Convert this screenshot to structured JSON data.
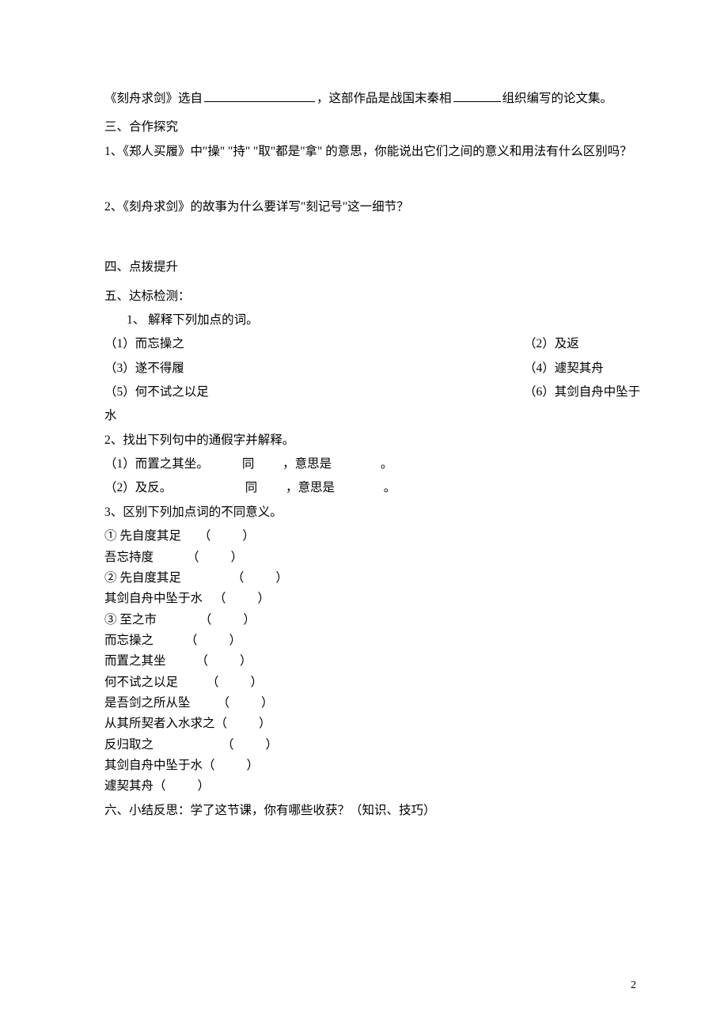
{
  "intro": {
    "text_a": "《刻舟求剑》选自",
    "text_b": "，这部作品是战国末秦相",
    "text_c": "组织编写的论文集。"
  },
  "sec3": {
    "title": "三、合作探究",
    "q1": "1、《郑人买履》中\"操\"  \"持\"  \"取\"都是\"拿\"  的意思，你能说出它们之间的意义和用法有什么区别吗？",
    "q2": "2、《刻舟求剑》的故事为什么要详写\"刻记号\"这一细节？"
  },
  "sec4": {
    "title": "四、点拨提升"
  },
  "sec5": {
    "title": "五、达标检测：",
    "q1": {
      "title": "1、  解释下列加点的词。",
      "items": [
        {
          "l": "（1）而忘操之",
          "r": "（2）及返"
        },
        {
          "l": "（3）遂不得履",
          "r": "（4）遽契其舟"
        },
        {
          "l": "（5）何不试之以足",
          "r": "（6）其剑自舟中坠于"
        }
      ],
      "tail": "水"
    },
    "q2": {
      "title": "2、找出下列句中的通假字并解释。",
      "a_phrase": "（1）而置之其坐。",
      "b_phrase": "（2）及反。",
      "tong": "同",
      "yisi": "，意思是",
      "dot": "。"
    },
    "q3": {
      "title": "3、区别下列加点词的不同意义。",
      "rows": [
        {
          "label": "①  先自度其足",
          "pad": 22
        },
        {
          "label": "吾忘持度",
          "pad": 42
        },
        {
          "label": "②  先自度其足",
          "pad": 64
        },
        {
          "label": "其剑自舟中坠于水",
          "pad": 14
        },
        {
          "label": "③  至之市",
          "pad": 54
        },
        {
          "label": "而忘操之",
          "pad": 40
        },
        {
          "label": "而置之其坐",
          "pad": 38
        },
        {
          "label": "何不试之以足",
          "pad": 36
        },
        {
          "label": "是吾剑之所从坠",
          "pad": 34
        },
        {
          "label": "从其所契者入水求之",
          "pad": 0
        },
        {
          "label": "反归取之",
          "pad": 86
        },
        {
          "label": "其剑自舟中坠于水",
          "pad": 0
        },
        {
          "label": "遽契其舟",
          "pad": 0
        }
      ]
    }
  },
  "sec6": {
    "title": "六、小结反思：学了这节课，你有哪些收获？（知识、技巧）"
  },
  "page_num": "2"
}
